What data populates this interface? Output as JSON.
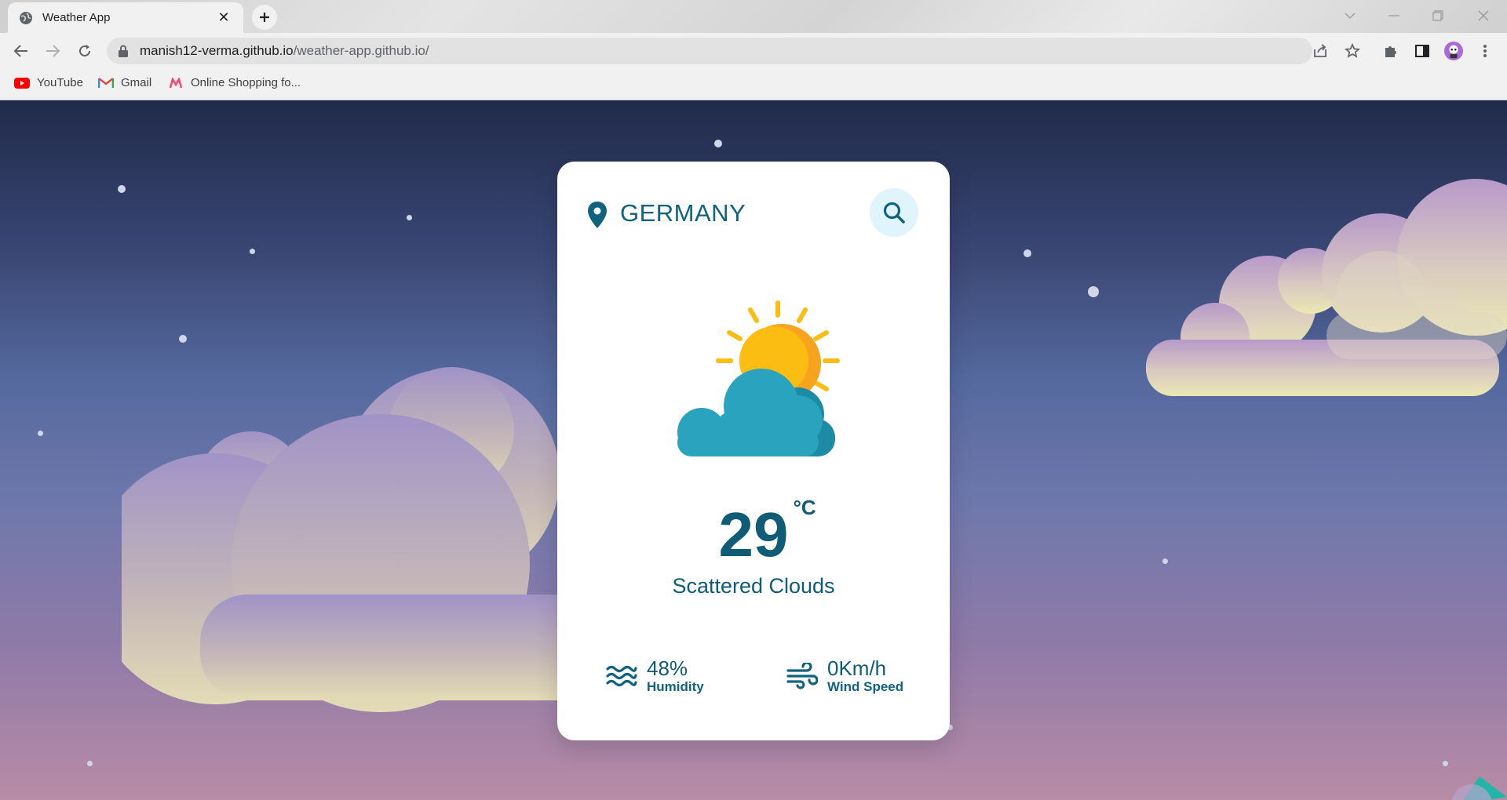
{
  "browser": {
    "tab_title": "Weather App",
    "url_host": "manish12-verma.github.io",
    "url_path": "/weather-app.github.io/",
    "bookmarks": [
      {
        "label": "YouTube",
        "icon": "youtube-icon"
      },
      {
        "label": "Gmail",
        "icon": "gmail-icon"
      },
      {
        "label": "Online Shopping fo...",
        "icon": "myntra-icon"
      }
    ]
  },
  "weather": {
    "location": "GERMANY",
    "temperature": "29",
    "unit": "°C",
    "description": "Scattered Clouds",
    "humidity_value": "48%",
    "humidity_label": "Humidity",
    "wind_value": "0Km/h",
    "wind_label": "Wind Speed",
    "condition_icon": "sun-behind-cloud-icon"
  },
  "colors": {
    "primary_text": "#0f5c76",
    "search_bg": "#e0f4fb",
    "cloud_blue": "#2aa3bf",
    "sun_yellow": "#fbbd12",
    "sun_orange": "#f6a31d"
  }
}
